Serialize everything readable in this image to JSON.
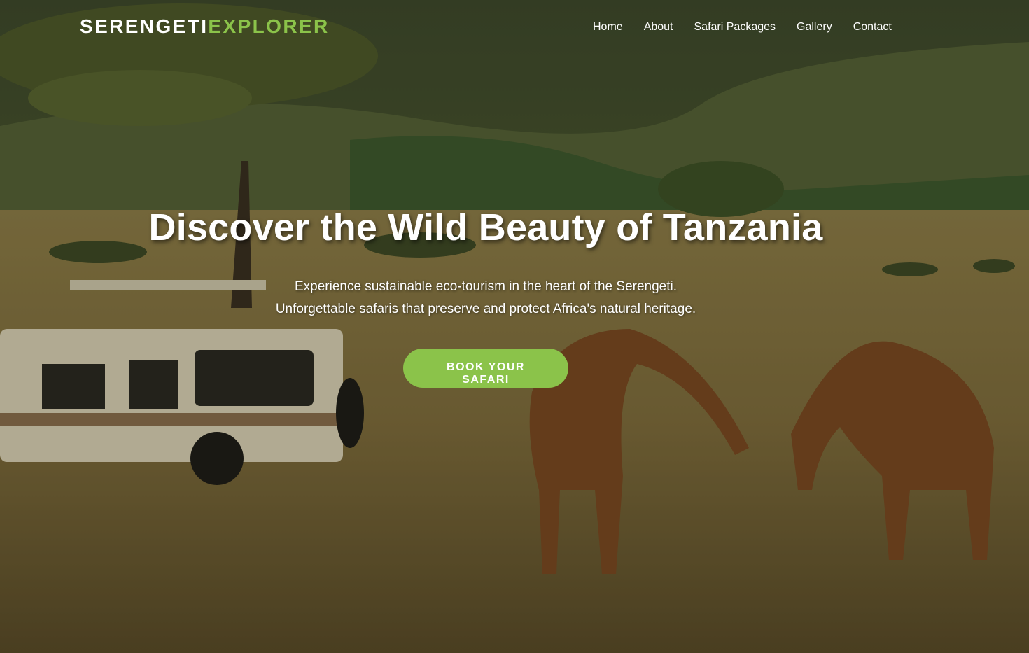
{
  "brand": {
    "primary": "SERENGETI",
    "accent": "EXPLORER",
    "accent_color": "#8bc34a"
  },
  "nav": {
    "items": [
      {
        "label": "Home"
      },
      {
        "label": "About"
      },
      {
        "label": "Safari Packages"
      },
      {
        "label": "Gallery"
      },
      {
        "label": "Contact"
      }
    ]
  },
  "hero": {
    "title": "Discover the Wild Beauty of Tanzania",
    "subtitle_line1": "Experience sustainable eco-tourism in the heart of the Serengeti.",
    "subtitle_line2": "Unforgettable safaris that preserve and protect Africa's natural heritage.",
    "cta_label": "BOOK YOUR SAFARI",
    "cta_color": "#8bc34a"
  }
}
